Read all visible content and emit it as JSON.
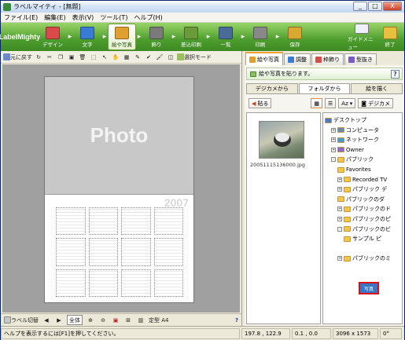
{
  "window": {
    "title": "ラベルマイティ - [無題]",
    "minimize": "_",
    "maximize": "□",
    "close": "X"
  },
  "menu": [
    "ファイル(E)",
    "編集(E)",
    "表示(V)",
    "ツール(T)",
    "ヘルプ(H)"
  ],
  "brand": "LabelMighty",
  "main_buttons": [
    {
      "label": "デザイン",
      "icon": "design-icon",
      "color": "#d94a4a"
    },
    {
      "label": "文字",
      "icon": "text-icon",
      "color": "#3a7bd5"
    },
    {
      "label": "絵や写真",
      "icon": "image-icon",
      "color": "#e0a030",
      "selected": true
    },
    {
      "label": "飾り",
      "icon": "decoration-icon",
      "color": "#7a7a7a"
    },
    {
      "label": "差込印刷",
      "icon": "mailmerge-icon",
      "color": "#6a9a3a"
    },
    {
      "label": "一覧",
      "icon": "list-icon",
      "color": "#4a6a9a"
    },
    {
      "label": "印刷",
      "icon": "print-icon",
      "color": "#888888"
    },
    {
      "label": "保存",
      "icon": "save-icon",
      "color": "#d8a830"
    }
  ],
  "right_buttons": [
    {
      "label": "ガイドメニュー",
      "icon": "guide-icon"
    },
    {
      "label": "終了",
      "icon": "exit-icon"
    }
  ],
  "edit_toolbar": {
    "undo_label": "元に戻す",
    "select_label": "選択モード"
  },
  "page": {
    "photo_label": "Photo",
    "year": "2007"
  },
  "bottom_left": {
    "label_list": "ラベル切替",
    "zoom_all": "全体",
    "zoom_label": "定型 A4"
  },
  "panel": {
    "tabs": [
      {
        "label": "絵や写真",
        "active": true,
        "color": "#e0a030"
      },
      {
        "label": "調整",
        "color": "#3a7bd5"
      },
      {
        "label": "枠飾り",
        "color": "#d94a4a"
      },
      {
        "label": "型抜き",
        "color": "#7a5ac8"
      }
    ],
    "header": "絵や写真を貼ります。",
    "help": "?",
    "subtabs": [
      {
        "label": "デジカメから"
      },
      {
        "label": "フォルダから",
        "active": true
      },
      {
        "label": "絵を描く"
      }
    ],
    "toolbar": {
      "paste": "貼る",
      "sort": "Az",
      "camera": "デジカメ"
    },
    "thumb_label": "20051115136000.jpg",
    "tree": [
      {
        "label": "デスクトップ",
        "indent": 0,
        "kind": "desktop"
      },
      {
        "label": "コンピュータ",
        "indent": 1,
        "kind": "pc",
        "expander": "+"
      },
      {
        "label": "ネットワーク",
        "indent": 1,
        "kind": "net",
        "expander": "+"
      },
      {
        "label": "Owner",
        "indent": 1,
        "kind": "user",
        "expander": "+"
      },
      {
        "label": "パブリック",
        "indent": 1,
        "kind": "folder",
        "expander": "-"
      },
      {
        "label": "Favorites",
        "indent": 2,
        "kind": "folder"
      },
      {
        "label": "Recorded TV",
        "indent": 2,
        "kind": "folder",
        "expander": "+"
      },
      {
        "label": "パブリック デ",
        "indent": 2,
        "kind": "folder",
        "expander": "+"
      },
      {
        "label": "パブリックのダ",
        "indent": 2,
        "kind": "folder"
      },
      {
        "label": "パブリックのド",
        "indent": 2,
        "kind": "folder",
        "expander": "+"
      },
      {
        "label": "パブリックのピ",
        "indent": 2,
        "kind": "folder",
        "expander": "+"
      },
      {
        "label": "パブリックのビ",
        "indent": 2,
        "kind": "folder",
        "expander": "-"
      },
      {
        "label": "サンプル ピ",
        "indent": 3,
        "kind": "folder"
      },
      {
        "label": "",
        "indent": 3,
        "kind": "spacer"
      },
      {
        "label": "パブリックのミ",
        "indent": 2,
        "kind": "folder",
        "expander": "+"
      }
    ],
    "highlighted_node": "写真"
  },
  "status": {
    "help_text": "ヘルプを表示するには[F1]を押してください。",
    "coords": "197.8 , 122.9",
    "size": "0.1 , 0.0",
    "image_size": "3096 x 1573",
    "angle": "0°"
  }
}
